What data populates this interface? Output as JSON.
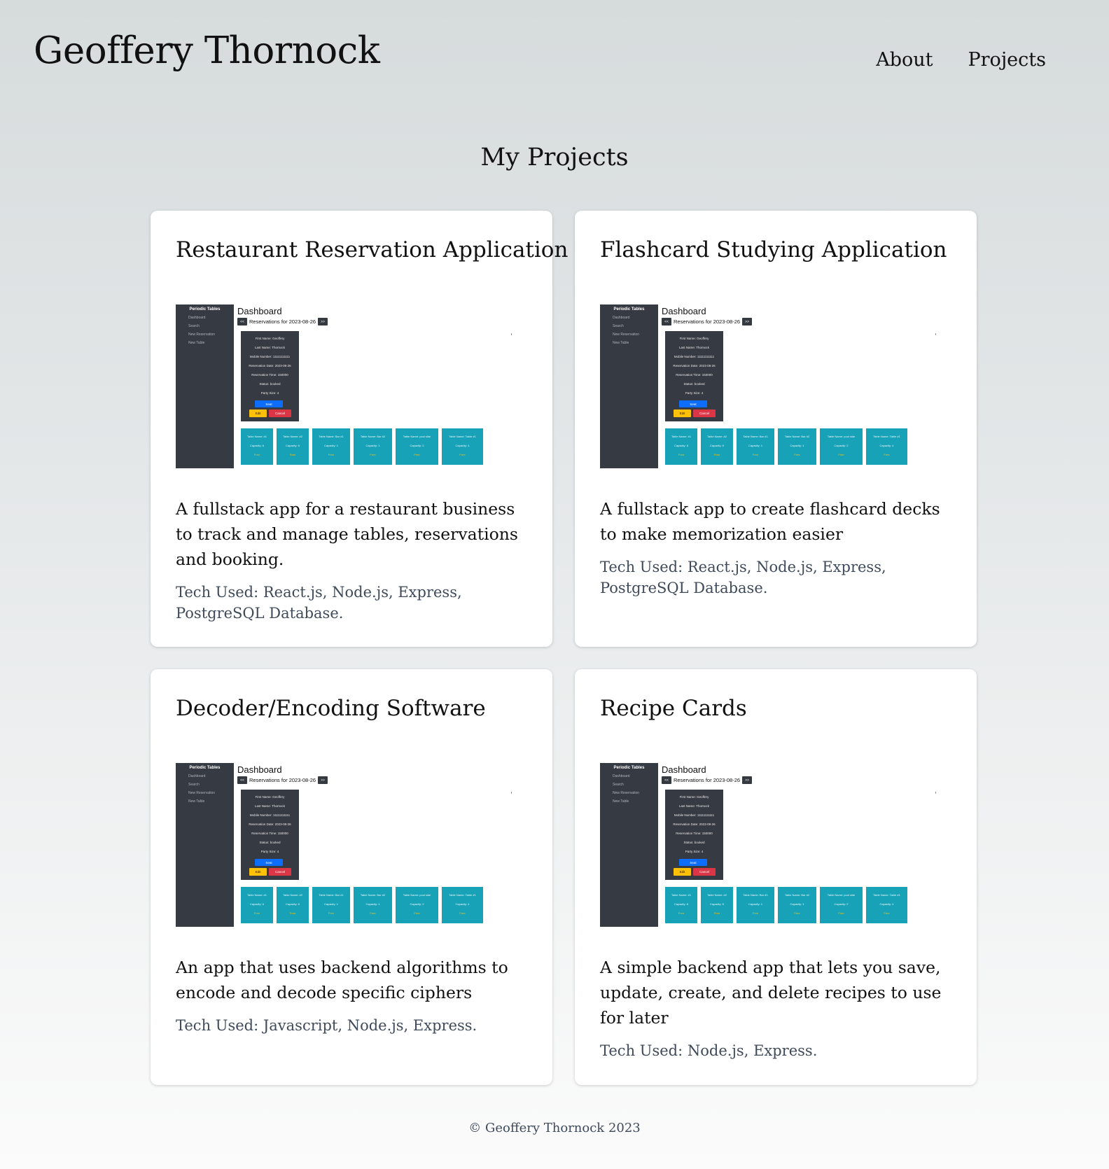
{
  "header": {
    "title": "Geoffery Thornock",
    "nav": [
      {
        "label": "About"
      },
      {
        "label": "Projects"
      }
    ]
  },
  "main": {
    "section_title": "My Projects",
    "projects": [
      {
        "title": "Restaurant Reservation Application",
        "description": "A fullstack app for a restaurant business to track and manage tables, reservations and booking.",
        "tech": "Tech Used: React.js, Node.js, Express, PostgreSQL Database."
      },
      {
        "title": "Flashcard Studying Application",
        "description": "A fullstack app to create flashcard decks to make memorization easier",
        "tech": "Tech Used: React.js, Node.js, Express, PostgreSQL Database."
      },
      {
        "title": "Decoder/Encoding Software",
        "description": "An app that uses backend algorithms to encode and decode specific ciphers",
        "tech": "Tech Used: Javascript, Node.js, Express."
      },
      {
        "title": "Recipe Cards",
        "description": "A simple backend app that lets you save, update, create, and delete recipes to use for later",
        "tech": "Tech Used: Node.js, Express."
      }
    ]
  },
  "screenshot": {
    "sidebar_title": "Periodic Tables",
    "sidebar_items": [
      "Dashboard",
      "Search",
      "New Reservation",
      "New Table"
    ],
    "heading": "Dashboard",
    "prev": "<<",
    "next": ">>",
    "date_text": "Reservations for 2023-08-26",
    "reservation_lines": [
      "First Name: Geoffery",
      "Last Name: Thornock",
      "Mobile Number: 11111111111",
      "Reservation Date: 2023-08-26",
      "Reservation Time: 150000",
      "Status: booked",
      "Party Size: 4"
    ],
    "seat": "Seat",
    "edit": "Edit",
    "cancel": "Cancel",
    "tables": [
      {
        "name": "Table Name: #1",
        "capacity": "Capacity: 6",
        "status": "Free"
      },
      {
        "name": "Table Name: #2",
        "capacity": "Capacity: 6",
        "status": "Free"
      },
      {
        "name": "Table Name: Bar #1",
        "capacity": "Capacity: 1",
        "status": "Free"
      },
      {
        "name": "Table Name: Bar #2",
        "capacity": "Capacity: 1",
        "status": "Free"
      },
      {
        "name": "Table Name: pool side",
        "capacity": "Capacity: 2",
        "status": "Free"
      },
      {
        "name": "Table Name: Table #1",
        "capacity": "Capacity: 4",
        "status": "Free"
      }
    ]
  },
  "footer": {
    "copyright": "© Geoffery Thornock 2023"
  }
}
